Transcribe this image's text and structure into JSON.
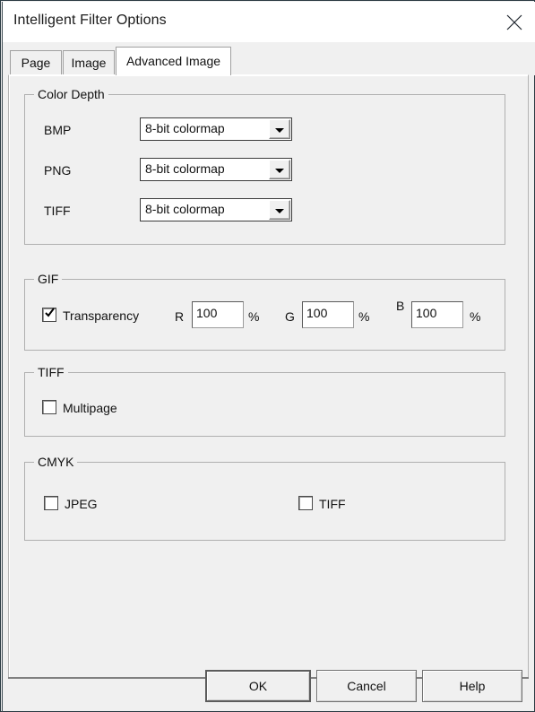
{
  "window": {
    "title": "Intelligent Filter Options",
    "close_icon": "close-icon"
  },
  "tabs": [
    {
      "id": "page",
      "label": "Page",
      "active": false
    },
    {
      "id": "image",
      "label": "Image",
      "active": false
    },
    {
      "id": "advanced_image",
      "label": "Advanced Image",
      "active": true
    }
  ],
  "groups": {
    "color_depth": {
      "title": "Color Depth",
      "rows": [
        {
          "label": "BMP",
          "value": "8-bit colormap"
        },
        {
          "label": "PNG",
          "value": "8-bit colormap"
        },
        {
          "label": "TIFF",
          "value": "8-bit colormap"
        }
      ]
    },
    "gif": {
      "title": "GIF",
      "transparency": {
        "label": "Transparency",
        "checked": true
      },
      "channels": [
        {
          "label": "R",
          "value": "100",
          "unit": "%"
        },
        {
          "label": "G",
          "value": "100",
          "unit": "%"
        },
        {
          "label": "B",
          "value": "100",
          "unit": "%"
        }
      ]
    },
    "tiff": {
      "title": "TIFF",
      "multipage": {
        "label": "Multipage",
        "checked": false
      }
    },
    "cmyk": {
      "title": "CMYK",
      "options": [
        {
          "label": "JPEG",
          "checked": false
        },
        {
          "label": "TIFF",
          "checked": false
        }
      ]
    }
  },
  "buttons": {
    "ok": "OK",
    "cancel": "Cancel",
    "help": "Help"
  },
  "colors": {
    "dialog_background": "#f0f0f0",
    "titlebar_background": "#ffffff",
    "text": "#111111",
    "group_border": "#b0b0b0",
    "field_background": "#ffffff"
  }
}
